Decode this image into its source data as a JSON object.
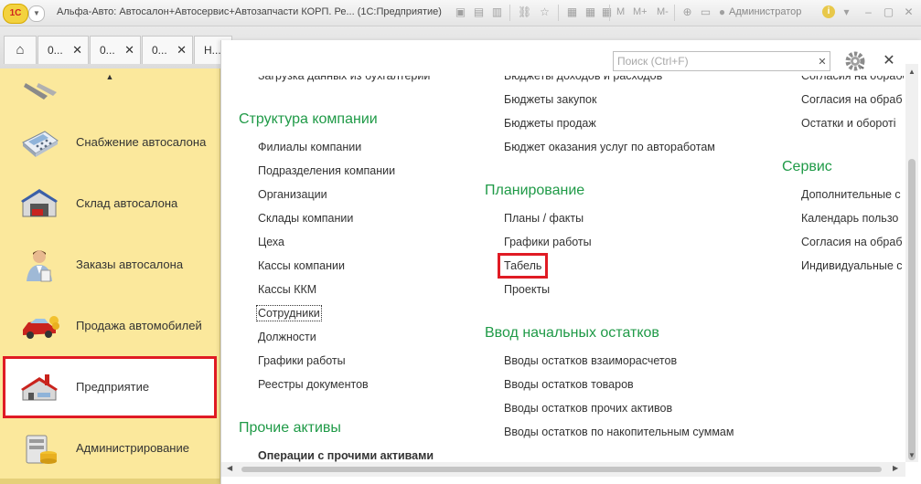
{
  "titlebar": {
    "logo": "1С",
    "title": "Альфа-Авто: Автосалон+Автосервис+Автозапчасти КОРП. Ре...  (1С:Предприятие)",
    "m_labels": [
      "M",
      "M+",
      "M-"
    ],
    "user": "Администратор"
  },
  "tabs": [
    {
      "label": "0..."
    },
    {
      "label": "0..."
    },
    {
      "label": "0..."
    },
    {
      "label": "Н..."
    }
  ],
  "sidebar": {
    "items": [
      {
        "label": "Снабжение автосалона",
        "icon": "calculator-icon"
      },
      {
        "label": "Склад автосалона",
        "icon": "warehouse-icon"
      },
      {
        "label": "Заказы автосалона",
        "icon": "person-icon"
      },
      {
        "label": "Продажа автомобилей",
        "icon": "cars-icon"
      },
      {
        "label": "Предприятие",
        "icon": "factory-icon"
      },
      {
        "label": "Администрирование",
        "icon": "database-icon"
      }
    ]
  },
  "panel": {
    "search_placeholder": "Поиск (Ctrl+F)",
    "col1": {
      "top_item": "Загрузка данных из бухгалтерии",
      "groups": [
        {
          "title": "Структура компании",
          "items": [
            "Филиалы компании",
            "Подразделения компании",
            "Организации",
            "Склады компании",
            "Цеха",
            "Кассы компании",
            "Кассы ККМ",
            "Сотрудники",
            "Должности",
            "Графики работы",
            "Реестры документов"
          ]
        },
        {
          "title": "Прочие активы",
          "items": [
            "Операции с прочими активами"
          ]
        }
      ]
    },
    "col2": {
      "top_items": [
        "Бюджеты доходов и расходов",
        "Бюджеты закупок",
        "Бюджеты продаж",
        "Бюджет оказания услуг по автоработам"
      ],
      "groups": [
        {
          "title": "Планирование",
          "items": [
            "Планы / факты",
            "Графики работы",
            "Табель",
            "Проекты"
          ]
        },
        {
          "title": "Ввод начальных остатков",
          "items": [
            "Вводы остатков взаиморасчетов",
            "Вводы остатков товаров",
            "Вводы остатков прочих активов",
            "Вводы остатков по накопительным суммам"
          ]
        }
      ]
    },
    "col3": {
      "top_items": [
        "Согласия на обрабо",
        "Согласия на обраб",
        "Остатки и оборотi"
      ],
      "groups": [
        {
          "title": "Сервис",
          "items": [
            "Дополнительные с",
            "Календарь пользо",
            "Согласия на обраб",
            "Индивидуальные с"
          ]
        }
      ]
    }
  },
  "colors": {
    "sidebar_bg": "#fbe89c",
    "group_title": "#1f9a47",
    "highlight": "#e01b24"
  }
}
